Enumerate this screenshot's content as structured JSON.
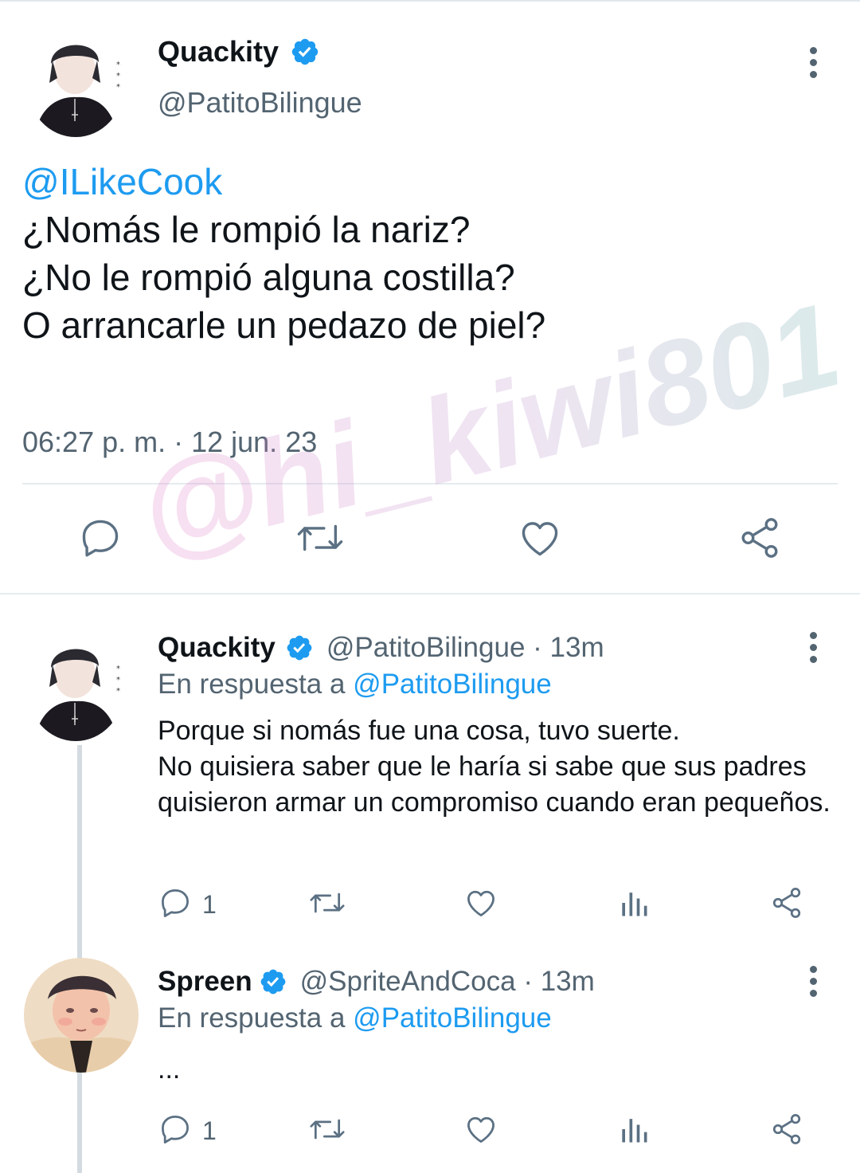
{
  "main_tweet": {
    "display_name": "Quackity",
    "handle": "@PatitoBilingue",
    "mention": "@ILikeCook",
    "lines": [
      "¿Nomás le rompió la nariz?",
      "¿No le rompió alguna costilla?",
      "O arrancarle un pedazo de piel?"
    ],
    "timestamp": "06:27 p. m. · 12 jun. 23",
    "actions": [
      "reply-icon",
      "retweet-icon",
      "like-icon",
      "share-icon"
    ]
  },
  "replies": [
    {
      "display_name": "Quackity",
      "meta": "@PatitoBilingue · 13m",
      "reply_prefix": "En respuesta a",
      "reply_mention": "@PatitoBilingue",
      "text": "Porque si nomás fue una cosa, tuvo suerte.\nNo quisiera saber que le haría si sabe que sus padres quisieron armar un compromiso cuando eran pequeños.",
      "reply_count": "1"
    },
    {
      "display_name": "Spreen",
      "meta": "@SpriteAndCoca · 13m",
      "reply_prefix": "En respuesta a",
      "reply_mention": "@PatitoBilingue",
      "text": "...",
      "reply_count": "1"
    }
  ],
  "watermark": "@hi_kiwi801",
  "colors": {
    "link": "#1d9bf0",
    "secondary": "#536471",
    "verified": "#1d9bf0",
    "divider": "#e6ecf0"
  }
}
